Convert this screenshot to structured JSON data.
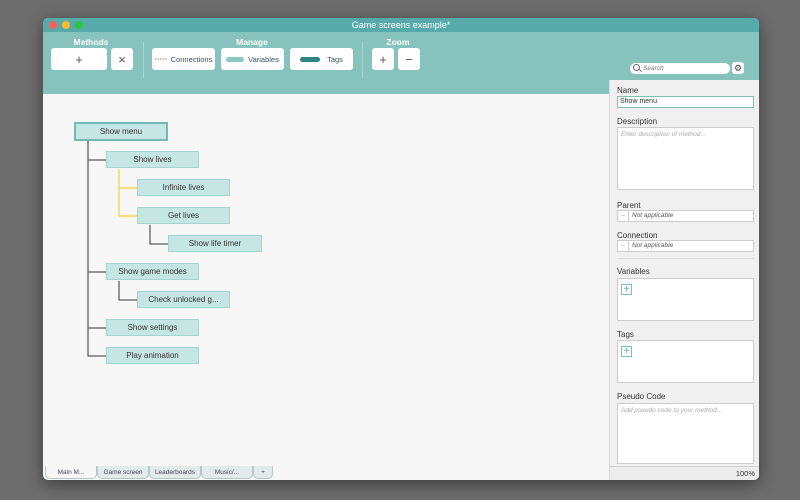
{
  "window": {
    "title": "Game screens example*"
  },
  "toolbar": {
    "methods": {
      "label": "Methods",
      "add_icon": "+",
      "remove_icon": "×"
    },
    "manage": {
      "label": "Manage",
      "connections": "Connections",
      "variables": "Variables",
      "tags": "Tags"
    },
    "zoom": {
      "label": "Zoom",
      "in_icon": "+",
      "out_icon": "−"
    },
    "search": {
      "placeholder": "Search"
    }
  },
  "tree": {
    "nodes": [
      {
        "id": "show-menu",
        "label": "Show menu"
      },
      {
        "id": "show-lives",
        "label": "Show lives"
      },
      {
        "id": "infinite-lives",
        "label": "Infinite lives"
      },
      {
        "id": "get-lives",
        "label": "Get lives"
      },
      {
        "id": "show-life-timer",
        "label": "Show life timer"
      },
      {
        "id": "show-game-modes",
        "label": "Show game modes"
      },
      {
        "id": "check-unlocked",
        "label": "Check unlocked g..."
      },
      {
        "id": "show-settings",
        "label": "Show settings"
      },
      {
        "id": "play-animation",
        "label": "Play animation"
      }
    ],
    "colors": {
      "node_fill": "#c6e6e3",
      "line_dark": "#333333",
      "line_yellow": "#f2d430"
    }
  },
  "tabs": [
    {
      "label": "Main M..."
    },
    {
      "label": "Game screen"
    },
    {
      "label": "Leaderboards"
    },
    {
      "label": "Music/..."
    },
    {
      "label": "+"
    }
  ],
  "panel": {
    "name_label": "Name",
    "name_value": "Show menu",
    "description_label": "Description",
    "description_placeholder": "Enter description of method...",
    "parent_label": "Parent",
    "parent_value": "Not applicable",
    "connection_label": "Connection",
    "connection_value": "Not applicable",
    "variables_label": "Variables",
    "tags_label": "Tags",
    "pseudo_label": "Pseudo Code",
    "pseudo_placeholder": "Add pseudo code to your method...",
    "add_icon": "+"
  },
  "status": {
    "zoom": "100%"
  },
  "colors": {
    "accent": "#86c3bd",
    "titlebar": "#56aaa9",
    "tag_swatch": "#2f8583"
  }
}
